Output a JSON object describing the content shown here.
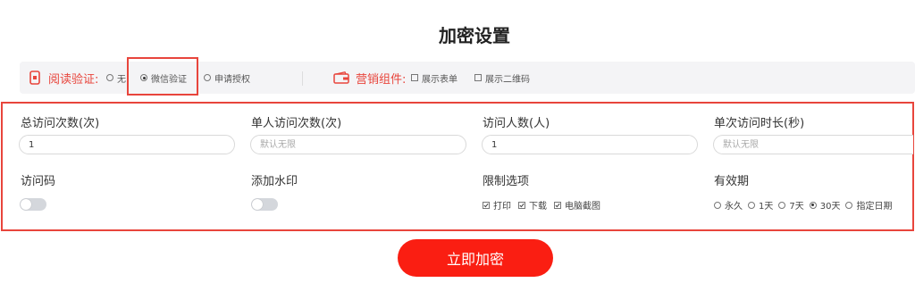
{
  "page": {
    "title": "加密设置"
  },
  "toolbar": {
    "read_verify_label": "阅读验证:",
    "read_options": [
      {
        "label": "无",
        "selected": false
      },
      {
        "label": "微信验证",
        "selected": true
      },
      {
        "label": "申请授权",
        "selected": false
      }
    ],
    "marketing_label": "营销组件:",
    "marketing_options": [
      {
        "label": "展示表单",
        "checked": false
      },
      {
        "label": "展示二维码",
        "checked": false
      }
    ],
    "accent_color": "#e8453c"
  },
  "settings": {
    "total_visits_label": "总访问次数(次)",
    "total_visits_value": "1",
    "per_user_visits_label": "单人访问次数(次)",
    "per_user_visits_placeholder": "默认无限",
    "visitor_count_label": "访问人数(人)",
    "visitor_count_value": "1",
    "duration_label": "单次访问时长(秒)",
    "duration_placeholder": "默认无限",
    "access_code_label": "访问码",
    "access_code_enabled": false,
    "watermark_label": "添加水印",
    "watermark_enabled": false,
    "restrict_label": "限制选项",
    "restrict_options": [
      {
        "label": "打印",
        "checked": true
      },
      {
        "label": "下载",
        "checked": true
      },
      {
        "label": "电脑截图",
        "checked": true
      }
    ],
    "validity_label": "有效期",
    "validity_options": [
      {
        "label": "永久",
        "selected": false
      },
      {
        "label": "1天",
        "selected": false
      },
      {
        "label": "7天",
        "selected": false
      },
      {
        "label": "30天",
        "selected": true
      },
      {
        "label": "指定日期",
        "selected": false
      }
    ]
  },
  "submit": {
    "label": "立即加密",
    "color": "#fa1e12"
  }
}
